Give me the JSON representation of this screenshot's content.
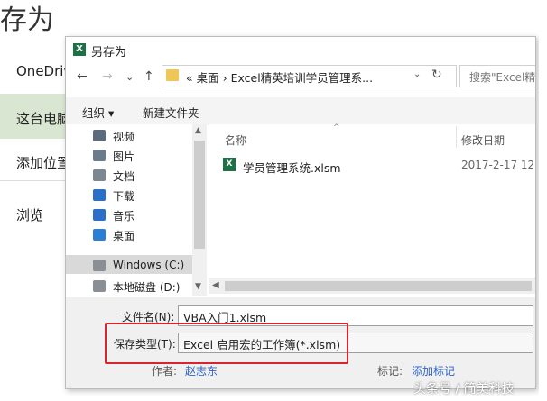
{
  "backstage": {
    "title": "存为",
    "nav": [
      "OneDriv",
      "这台电脑",
      "添加位置",
      "浏览"
    ]
  },
  "dialog": {
    "title": "另存为",
    "title_icon": "X",
    "nav": {
      "back": "←",
      "forward": "→",
      "dropdown": "⌄",
      "up": "↑"
    },
    "address": "«  桌面  ›  Excel精英培训学员管理系...",
    "address_dropdown": "⌄",
    "refresh": "↻",
    "search_placeholder": "搜索\"Excel精",
    "toolbar": {
      "organize": "组织 ▾",
      "new_folder": "新建文件夹"
    },
    "tree": [
      {
        "label": "视频",
        "icon": "video-icon",
        "color": "#5b6b7b"
      },
      {
        "label": "图片",
        "icon": "pictures-icon",
        "color": "#6b7b8b"
      },
      {
        "label": "文档",
        "icon": "documents-icon",
        "color": "#7d8791"
      },
      {
        "label": "下载",
        "icon": "downloads-icon",
        "color": "#2a6fc9"
      },
      {
        "label": "音乐",
        "icon": "music-icon",
        "color": "#2a6fc9"
      },
      {
        "label": "桌面",
        "icon": "desktop-icon",
        "color": "#2a7fd4"
      },
      {
        "label": "Windows (C:)",
        "icon": "drive-icon",
        "color": "#8a8f95"
      },
      {
        "label": "本地磁盘 (D:)",
        "icon": "drive-icon",
        "color": "#8a8f95"
      }
    ],
    "columns": {
      "name": "名称",
      "date": "修改日期",
      "sort_caret": "^"
    },
    "files": [
      {
        "icon": "X",
        "name": "学员管理系统.xlsm",
        "date": "2017-2-17 12"
      }
    ],
    "filename_label": "文件名(N):",
    "filename_value": "VBA入门1.xlsm",
    "filetype_label": "保存类型(T):",
    "filetype_value": "Excel 启用宏的工作簿(*.xlsm)",
    "authors_label": "作者:",
    "authors_value": "赵志东",
    "tags_label": "标记:",
    "tags_value": "添加标记"
  },
  "watermark": "头条号 / 简美科技",
  "colors": {
    "excel_green": "#1e7145",
    "highlight_red": "#d9232e",
    "selected_nav": "#d9e6d2"
  }
}
